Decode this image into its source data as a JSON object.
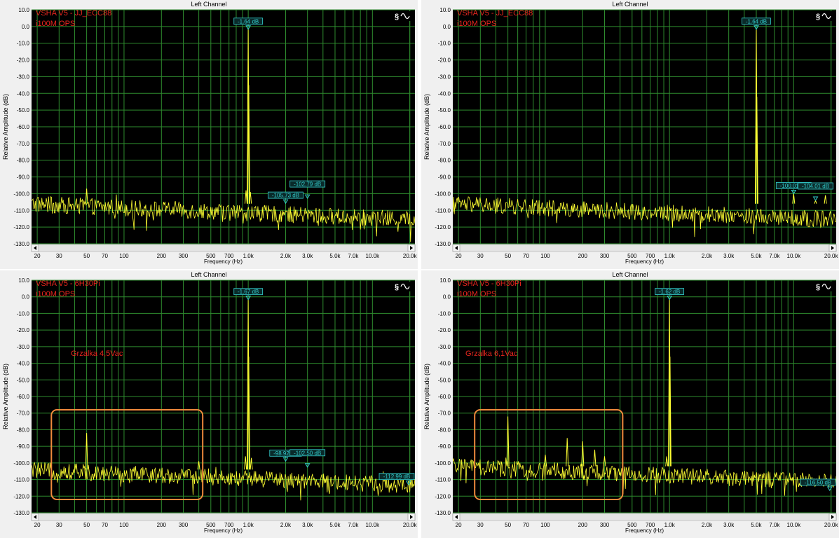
{
  "chart_data": [
    {
      "type": "line",
      "title": "Left Channel",
      "xlabel": "Frequency (Hz)",
      "ylabel": "Relative Amplitude (dB)",
      "xscale": "log",
      "xlim": [
        18,
        22000
      ],
      "ylim": [
        -130,
        10
      ],
      "x_ticks": [
        "20",
        "30",
        "50",
        "70",
        "100",
        "200",
        "300",
        "500",
        "700",
        "1.0k",
        "2.0k",
        "3.0k",
        "5.0k",
        "7.0k",
        "10.0k",
        "20.0k"
      ],
      "y_ticks": [
        "10.0",
        "0.0",
        "-10.0",
        "-20.0",
        "-30.0",
        "-40.0",
        "-50.0",
        "-60.0",
        "-70.0",
        "-80.0",
        "-90.0",
        "-100.0",
        "-110.0",
        "-120.0",
        "-130.0"
      ],
      "grid": true,
      "annotations": [
        "VSHA V5 - JJ_ECC88",
        "i100M OPS"
      ],
      "markers": [
        {
          "x": 1000,
          "y": -1.64,
          "label": "-1.64 dB"
        },
        {
          "x": 2000,
          "y": -105.73,
          "label": "-105.73 dB"
        },
        {
          "x": 3000,
          "y": -102.79,
          "label": "-102.79 dB"
        }
      ],
      "peaks": [
        {
          "x": 1000,
          "y": -1.64
        },
        {
          "x": 960,
          "y": -98
        },
        {
          "x": 1040,
          "y": -99
        },
        {
          "x": 1010,
          "y": -35
        },
        {
          "x": 50,
          "y": -97
        }
      ],
      "noise_floor": -110,
      "boxes": []
    },
    {
      "type": "line",
      "title": "Left Channel",
      "xlabel": "Frequency (Hz)",
      "ylabel": "Relative Amplitude (dB)",
      "xscale": "log",
      "xlim": [
        18,
        22000
      ],
      "ylim": [
        -130,
        10
      ],
      "x_ticks": [
        "20",
        "30",
        "50",
        "70",
        "100",
        "200",
        "300",
        "500",
        "700",
        "1.0k",
        "2.0k",
        "3.0k",
        "5.0k",
        "7.0k",
        "10.0k",
        "20.0k"
      ],
      "y_ticks": [
        "10.0",
        "0.0",
        "-10.0",
        "-20.0",
        "-30.0",
        "-40.0",
        "-50.0",
        "-60.0",
        "-70.0",
        "-80.0",
        "-90.0",
        "-100.0",
        "-110.0",
        "-120.0",
        "-130.0"
      ],
      "grid": true,
      "annotations": [
        "VSHA V5 - JJ_ECC88",
        "i100M OPS"
      ],
      "markers": [
        {
          "x": 5000,
          "y": -1.64,
          "label": "-1.64 dB"
        },
        {
          "x": 10000,
          "y": -100.01,
          "label": "-100.01 dB"
        },
        {
          "x": 15000,
          "y": -104.01,
          "label": "-104.01 dB"
        }
      ],
      "peaks": [
        {
          "x": 5000,
          "y": -1.64
        },
        {
          "x": 5050,
          "y": -42
        },
        {
          "x": 10000,
          "y": -100
        },
        {
          "x": 15000,
          "y": -104
        },
        {
          "x": 18000,
          "y": -101
        }
      ],
      "noise_floor": -110,
      "boxes": []
    },
    {
      "type": "line",
      "title": "Left Channel",
      "xlabel": "Frequency (Hz)",
      "ylabel": "Relative Amplitude (dB)",
      "xscale": "log",
      "xlim": [
        18,
        22000
      ],
      "ylim": [
        -130,
        10
      ],
      "x_ticks": [
        "20",
        "30",
        "50",
        "70",
        "100",
        "200",
        "300",
        "500",
        "700",
        "1.0k",
        "2.0k",
        "3.0k",
        "5.0k",
        "7.0k",
        "10.0k",
        "20.0k"
      ],
      "y_ticks": [
        "10.0",
        "0.0",
        "-10.0",
        "-20.0",
        "-30.0",
        "-40.0",
        "-50.0",
        "-60.0",
        "-70.0",
        "-80.0",
        "-90.0",
        "-100.0",
        "-110.0",
        "-120.0",
        "-130.0"
      ],
      "grid": true,
      "annotations": [
        "VSHA V5 - 6H30Pi",
        "i100M OPS",
        "Grzalka 4,5Vac"
      ],
      "markers": [
        {
          "x": 1000,
          "y": -1.67,
          "label": "-1.67 dB"
        },
        {
          "x": 2000,
          "y": -98.92,
          "label": "-98.92 dB"
        },
        {
          "x": 3000,
          "y": -102.5,
          "label": "-102.50 dB"
        },
        {
          "x": 19500,
          "y": -112.99,
          "label": "-112.99 dB"
        }
      ],
      "peaks": [
        {
          "x": 1000,
          "y": -1.67
        },
        {
          "x": 1010,
          "y": -36
        },
        {
          "x": 50,
          "y": -82
        },
        {
          "x": 950,
          "y": -96
        },
        {
          "x": 1060,
          "y": -97
        },
        {
          "x": 400,
          "y": -99
        }
      ],
      "noise_floor": -108,
      "boxes": [
        {
          "x0": 26,
          "x1": 430,
          "y0": -68,
          "y1": -122
        }
      ]
    },
    {
      "type": "line",
      "title": "Left Channel",
      "xlabel": "Frequency (Hz)",
      "ylabel": "Relative Amplitude (dB)",
      "xscale": "log",
      "xlim": [
        18,
        22000
      ],
      "ylim": [
        -130,
        10
      ],
      "x_ticks": [
        "20",
        "30",
        "50",
        "70",
        "100",
        "200",
        "300",
        "500",
        "700",
        "1.0k",
        "2.0k",
        "3.0k",
        "5.0k",
        "7.0k",
        "10.0k",
        "20.0k"
      ],
      "y_ticks": [
        "10.0",
        "0.0",
        "-10.0",
        "-20.0",
        "-30.0",
        "-40.0",
        "-50.0",
        "-60.0",
        "-70.0",
        "-80.0",
        "-90.0",
        "-100.0",
        "-110.0",
        "-120.0",
        "-130.0"
      ],
      "grid": true,
      "annotations": [
        "VSHA V5 - 6H30Pi",
        "i100M OPS",
        "Grzalka 6,1Vac"
      ],
      "markers": [
        {
          "x": 1000,
          "y": -1.62,
          "label": "-1.62 dB"
        },
        {
          "x": 19500,
          "y": -116.5,
          "label": "-116.50 dB"
        }
      ],
      "peaks": [
        {
          "x": 1000,
          "y": -1.62
        },
        {
          "x": 1010,
          "y": -36
        },
        {
          "x": 50,
          "y": -72
        },
        {
          "x": 150,
          "y": -85
        },
        {
          "x": 100,
          "y": -95
        },
        {
          "x": 250,
          "y": -92
        },
        {
          "x": 200,
          "y": -87
        },
        {
          "x": 300,
          "y": -96
        },
        {
          "x": 950,
          "y": -96
        }
      ],
      "noise_floor": -106,
      "boxes": [
        {
          "x0": 27,
          "x1": 420,
          "y0": -68,
          "y1": -122
        }
      ]
    }
  ],
  "colors": {
    "plot_background": "#000000",
    "grid": "#2e8b2e",
    "trace": "#ffff33",
    "marker": "#33cccc",
    "annotation": "#e8261e",
    "box": "#f08a3c",
    "panel_background": "#f0f0f0"
  },
  "icons": {
    "toolbar": "sine-wave-icon",
    "scroll_left": "arrow-left-icon",
    "scroll_right": "arrow-right-icon"
  }
}
